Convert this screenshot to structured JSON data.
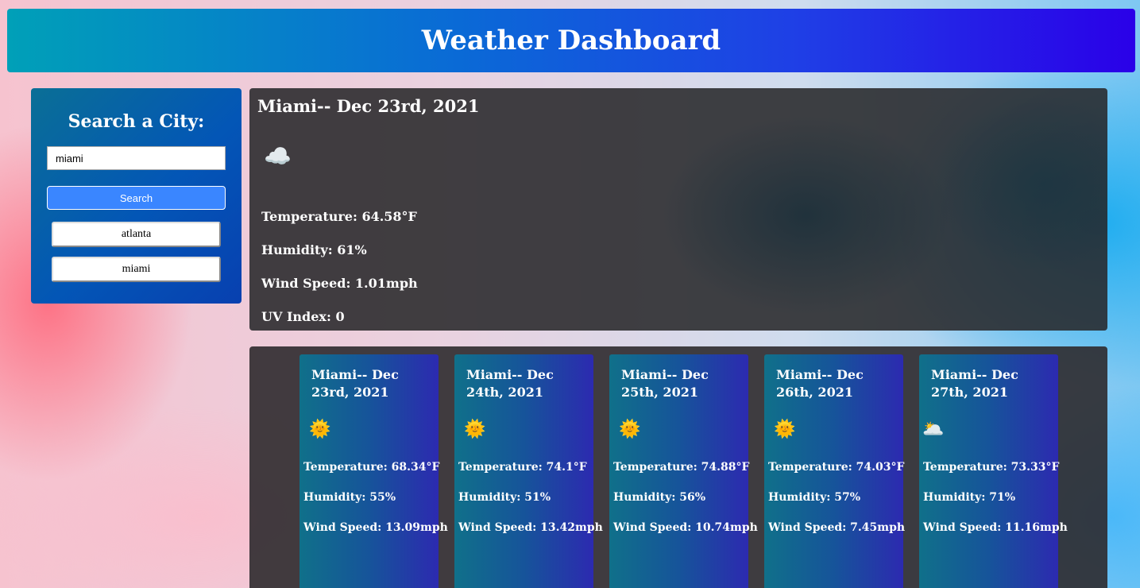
{
  "header": {
    "title": "Weather Dashboard"
  },
  "search": {
    "heading": "Search a City:",
    "input_value": "miami",
    "button_label": "Search",
    "history": [
      "atlanta",
      "miami"
    ]
  },
  "current": {
    "title": "Miami-- Dec 23rd, 2021",
    "icon": "cloud-moon-icon",
    "icon_glyph": "☁️",
    "temperature": "Temperature: 64.58°F",
    "humidity": "Humidity: 61%",
    "wind": "Wind Speed: 1.01mph",
    "uv": "UV Index: 0"
  },
  "forecast": [
    {
      "title": "Miami-- Dec 23rd, 2021",
      "icon": "sun-icon",
      "icon_glyph": "🌞",
      "temperature": "Temperature: 68.34°F",
      "humidity": "Humidity: 55%",
      "wind": "Wind Speed: 13.09mph"
    },
    {
      "title": "Miami-- Dec 24th, 2021",
      "icon": "sun-icon",
      "icon_glyph": "🌞",
      "temperature": "Temperature: 74.1°F",
      "humidity": "Humidity: 51%",
      "wind": "Wind Speed: 13.42mph"
    },
    {
      "title": "Miami-- Dec 25th, 2021",
      "icon": "sun-icon",
      "icon_glyph": "🌞",
      "temperature": "Temperature: 74.88°F",
      "humidity": "Humidity: 56%",
      "wind": "Wind Speed: 10.74mph"
    },
    {
      "title": "Miami-- Dec 26th, 2021",
      "icon": "sun-icon",
      "icon_glyph": "🌞",
      "temperature": "Temperature: 74.03°F",
      "humidity": "Humidity: 57%",
      "wind": "Wind Speed: 7.45mph"
    },
    {
      "title": "Miami-- Dec 27th, 2021",
      "icon": "cloud-icon",
      "icon_glyph": "🌥️",
      "temperature": "Temperature: 73.33°F",
      "humidity": "Humidity: 71%",
      "wind": "Wind Speed: 11.16mph"
    }
  ]
}
